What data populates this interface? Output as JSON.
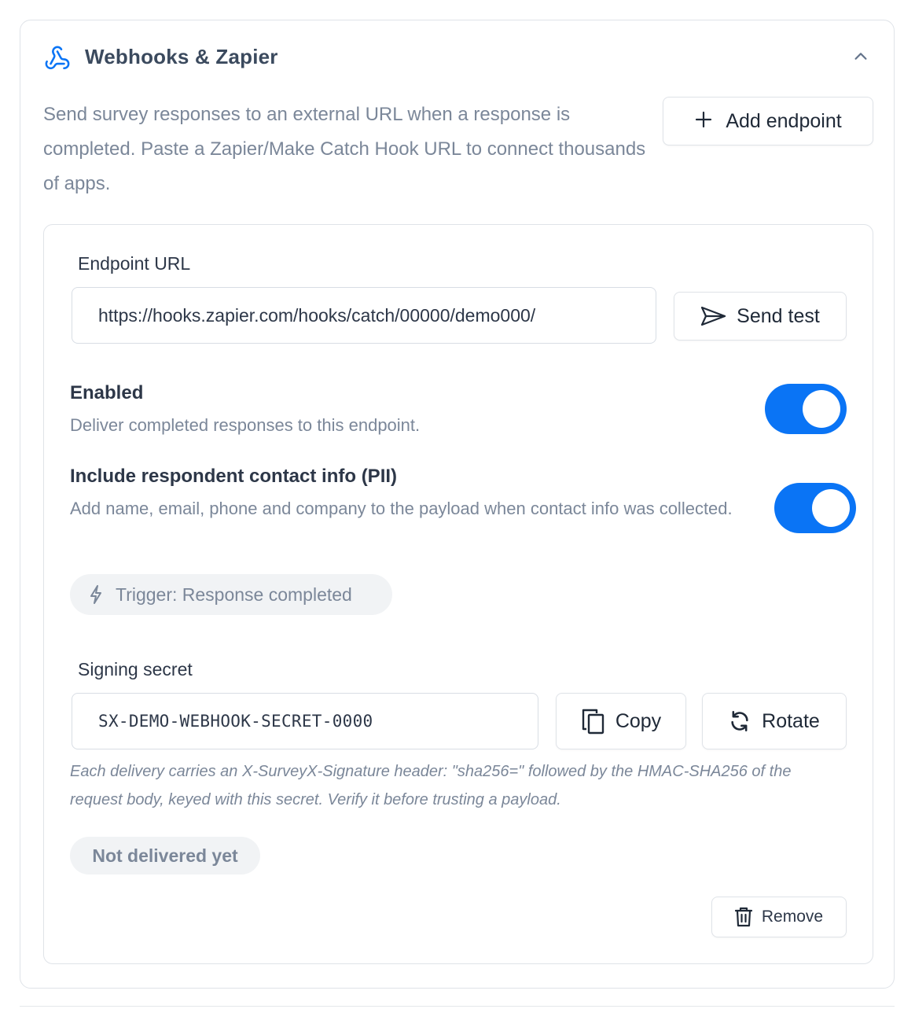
{
  "section": {
    "title": "Webhooks & Zapier",
    "description": "Send survey responses to an external URL when a response is completed. Paste a Zapier/Make Catch Hook URL to connect thousands of apps.",
    "add_endpoint_label": "Add endpoint",
    "accent_color": "#0a74f5"
  },
  "endpoint": {
    "url_label": "Endpoint URL",
    "url_value": "https://hooks.zapier.com/hooks/catch/00000/demo000/",
    "send_test_label": "Send test",
    "enabled": {
      "title": "Enabled",
      "subtitle": "Deliver completed responses to this endpoint.",
      "on": true
    },
    "pii": {
      "title": "Include respondent contact info (PII)",
      "subtitle": "Add name, email, phone and company to the payload when contact info was collected.",
      "on": true
    },
    "trigger_label": "Trigger: Response completed",
    "secret_label": "Signing secret",
    "secret_value": "SX-DEMO-WEBHOOK-SECRET-0000",
    "copy_label": "Copy",
    "rotate_label": "Rotate",
    "secret_hint": "Each delivery carries an X-SurveyX-Signature header: \"sha256=\" followed by the HMAC-SHA256 of the request body, keyed with this secret. Verify it before trusting a payload.",
    "status_label": "Not delivered yet",
    "remove_label": "Remove"
  },
  "icons": [
    "webhook-icon",
    "chevron-up-icon",
    "plus-icon",
    "send-icon",
    "bolt-icon",
    "copy-icon",
    "refresh-icon",
    "trash-icon"
  ]
}
